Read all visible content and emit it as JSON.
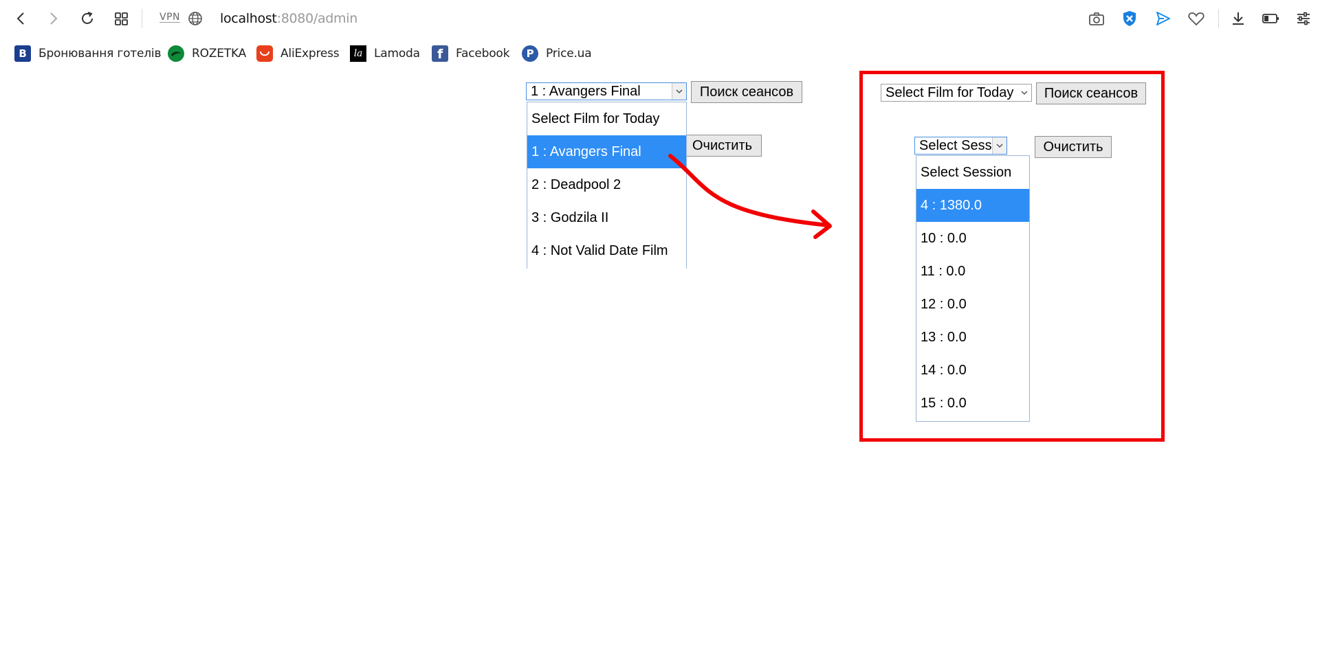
{
  "browser": {
    "vpn_label": "VPN",
    "url_host": "localhost",
    "url_path": ":8080/admin",
    "icons": [
      "back-icon",
      "forward-icon",
      "reload-icon",
      "grid-icon",
      "globe-icon",
      "camera-icon",
      "shield-icon",
      "send-icon",
      "heart-icon",
      "download-icon",
      "battery-icon",
      "settings-icon"
    ]
  },
  "bookmarks": [
    {
      "label": "Бронювання готелів",
      "icon": "B",
      "color": "#1b3f8f"
    },
    {
      "label": "ROZETKA",
      "icon": "",
      "color": "#0e8a3a"
    },
    {
      "label": "AliExpress",
      "icon": "",
      "color": "#e8401c"
    },
    {
      "label": "Lamoda",
      "icon": "la",
      "color": "#000000"
    },
    {
      "label": "Facebook",
      "icon": "f",
      "color": "#3b5998"
    },
    {
      "label": "Price.ua",
      "icon": "P",
      "color": "#2d5aa8"
    }
  ],
  "left_form": {
    "film_select_value": "1 : Avangers Final",
    "search_button": "Поиск сеансов",
    "clear_button": "Очистить",
    "film_options": [
      "Select Film for Today",
      "1 : Avangers Final",
      "2 : Deadpool 2",
      "3 : Godzila II",
      "4 : Not Valid Date Film"
    ]
  },
  "right_form": {
    "film_select_value": "Select Film for Today",
    "search_button": "Поиск сеансов",
    "session_select_value": "Select Session",
    "clear_button": "Очистить",
    "session_options": [
      "Select Session",
      "4 : 1380.0",
      "10 : 0.0",
      "11 : 0.0",
      "12 : 0.0",
      "13 : 0.0",
      "14 : 0.0",
      "15 : 0.0"
    ]
  },
  "annotation": {
    "arrow_color": "#f20000",
    "frame_color": "#f20000"
  }
}
